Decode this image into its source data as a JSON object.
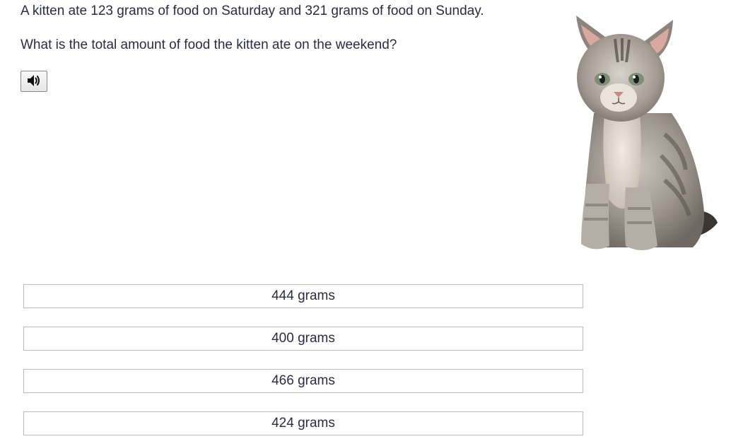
{
  "question": {
    "line1": "A kitten ate 123 grams of food on Saturday and 321 grams of food on Sunday.",
    "line2": "What is the total amount of food the kitten ate on the weekend?"
  },
  "audio_button": {
    "icon": "speaker-icon"
  },
  "illustration": {
    "subject": "kitten-image"
  },
  "answers": [
    {
      "label": "444 grams"
    },
    {
      "label": "400 grams"
    },
    {
      "label": "466 grams"
    },
    {
      "label": "424 grams"
    }
  ],
  "colors": {
    "text": "#2b2b45",
    "answer_border": "#b9b9c4",
    "button_border": "#8a8a8a"
  }
}
